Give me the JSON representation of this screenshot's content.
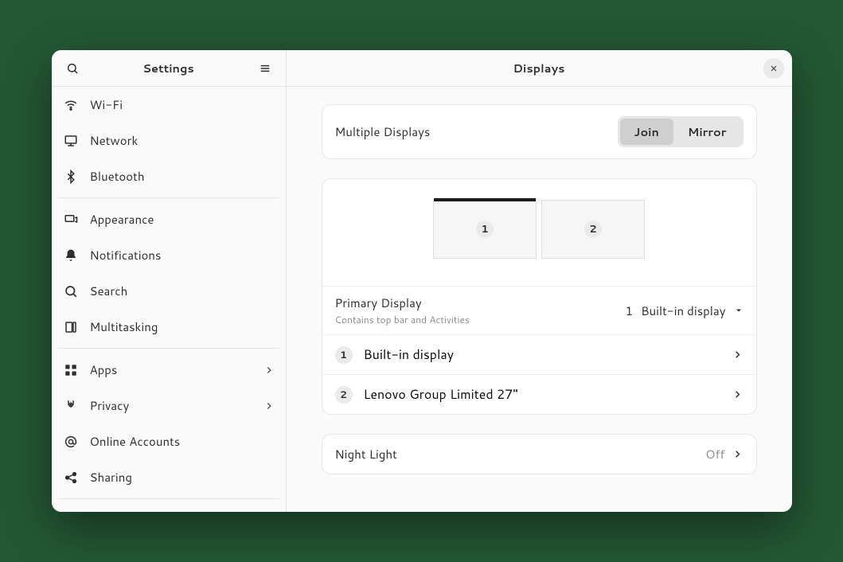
{
  "sidebar": {
    "title": "Settings",
    "groups": [
      [
        {
          "icon": "wifi",
          "label": "Wi-Fi"
        },
        {
          "icon": "network",
          "label": "Network"
        },
        {
          "icon": "bluetooth",
          "label": "Bluetooth"
        }
      ],
      [
        {
          "icon": "appearance",
          "label": "Appearance"
        },
        {
          "icon": "notifications",
          "label": "Notifications"
        },
        {
          "icon": "search",
          "label": "Search"
        },
        {
          "icon": "multitasking",
          "label": "Multitasking"
        }
      ],
      [
        {
          "icon": "apps",
          "label": "Apps",
          "submenu": true
        },
        {
          "icon": "privacy",
          "label": "Privacy",
          "submenu": true
        },
        {
          "icon": "online",
          "label": "Online Accounts"
        },
        {
          "icon": "sharing",
          "label": "Sharing"
        }
      ]
    ]
  },
  "page": {
    "title": "Displays",
    "multiple": {
      "label": "Multiple Displays",
      "options": [
        "Join",
        "Mirror"
      ],
      "active": "Join"
    },
    "arrangement": {
      "monitors": [
        {
          "num": "1",
          "primary": true
        },
        {
          "num": "2",
          "primary": false
        }
      ]
    },
    "primary": {
      "label": "Primary Display",
      "sub": "Contains top bar and Activities",
      "valueNum": "1",
      "valueName": "Built-in display"
    },
    "displays": [
      {
        "num": "1",
        "name": "Built-in display"
      },
      {
        "num": "2",
        "name": "Lenovo Group Limited 27\""
      }
    ],
    "nightlight": {
      "label": "Night Light",
      "value": "Off"
    }
  }
}
